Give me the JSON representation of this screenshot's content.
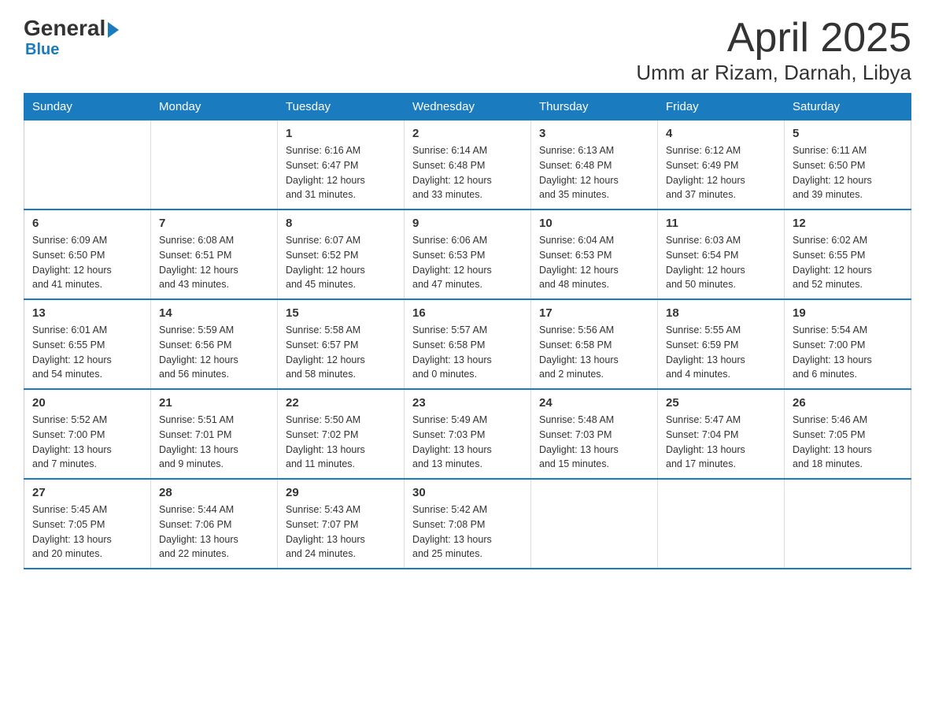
{
  "logo": {
    "general": "General",
    "blue": "Blue"
  },
  "title": "April 2025",
  "subtitle": "Umm ar Rizam, Darnah, Libya",
  "days_of_week": [
    "Sunday",
    "Monday",
    "Tuesday",
    "Wednesday",
    "Thursday",
    "Friday",
    "Saturday"
  ],
  "weeks": [
    [
      {
        "day": "",
        "info": ""
      },
      {
        "day": "",
        "info": ""
      },
      {
        "day": "1",
        "info": "Sunrise: 6:16 AM\nSunset: 6:47 PM\nDaylight: 12 hours\nand 31 minutes."
      },
      {
        "day": "2",
        "info": "Sunrise: 6:14 AM\nSunset: 6:48 PM\nDaylight: 12 hours\nand 33 minutes."
      },
      {
        "day": "3",
        "info": "Sunrise: 6:13 AM\nSunset: 6:48 PM\nDaylight: 12 hours\nand 35 minutes."
      },
      {
        "day": "4",
        "info": "Sunrise: 6:12 AM\nSunset: 6:49 PM\nDaylight: 12 hours\nand 37 minutes."
      },
      {
        "day": "5",
        "info": "Sunrise: 6:11 AM\nSunset: 6:50 PM\nDaylight: 12 hours\nand 39 minutes."
      }
    ],
    [
      {
        "day": "6",
        "info": "Sunrise: 6:09 AM\nSunset: 6:50 PM\nDaylight: 12 hours\nand 41 minutes."
      },
      {
        "day": "7",
        "info": "Sunrise: 6:08 AM\nSunset: 6:51 PM\nDaylight: 12 hours\nand 43 minutes."
      },
      {
        "day": "8",
        "info": "Sunrise: 6:07 AM\nSunset: 6:52 PM\nDaylight: 12 hours\nand 45 minutes."
      },
      {
        "day": "9",
        "info": "Sunrise: 6:06 AM\nSunset: 6:53 PM\nDaylight: 12 hours\nand 47 minutes."
      },
      {
        "day": "10",
        "info": "Sunrise: 6:04 AM\nSunset: 6:53 PM\nDaylight: 12 hours\nand 48 minutes."
      },
      {
        "day": "11",
        "info": "Sunrise: 6:03 AM\nSunset: 6:54 PM\nDaylight: 12 hours\nand 50 minutes."
      },
      {
        "day": "12",
        "info": "Sunrise: 6:02 AM\nSunset: 6:55 PM\nDaylight: 12 hours\nand 52 minutes."
      }
    ],
    [
      {
        "day": "13",
        "info": "Sunrise: 6:01 AM\nSunset: 6:55 PM\nDaylight: 12 hours\nand 54 minutes."
      },
      {
        "day": "14",
        "info": "Sunrise: 5:59 AM\nSunset: 6:56 PM\nDaylight: 12 hours\nand 56 minutes."
      },
      {
        "day": "15",
        "info": "Sunrise: 5:58 AM\nSunset: 6:57 PM\nDaylight: 12 hours\nand 58 minutes."
      },
      {
        "day": "16",
        "info": "Sunrise: 5:57 AM\nSunset: 6:58 PM\nDaylight: 13 hours\nand 0 minutes."
      },
      {
        "day": "17",
        "info": "Sunrise: 5:56 AM\nSunset: 6:58 PM\nDaylight: 13 hours\nand 2 minutes."
      },
      {
        "day": "18",
        "info": "Sunrise: 5:55 AM\nSunset: 6:59 PM\nDaylight: 13 hours\nand 4 minutes."
      },
      {
        "day": "19",
        "info": "Sunrise: 5:54 AM\nSunset: 7:00 PM\nDaylight: 13 hours\nand 6 minutes."
      }
    ],
    [
      {
        "day": "20",
        "info": "Sunrise: 5:52 AM\nSunset: 7:00 PM\nDaylight: 13 hours\nand 7 minutes."
      },
      {
        "day": "21",
        "info": "Sunrise: 5:51 AM\nSunset: 7:01 PM\nDaylight: 13 hours\nand 9 minutes."
      },
      {
        "day": "22",
        "info": "Sunrise: 5:50 AM\nSunset: 7:02 PM\nDaylight: 13 hours\nand 11 minutes."
      },
      {
        "day": "23",
        "info": "Sunrise: 5:49 AM\nSunset: 7:03 PM\nDaylight: 13 hours\nand 13 minutes."
      },
      {
        "day": "24",
        "info": "Sunrise: 5:48 AM\nSunset: 7:03 PM\nDaylight: 13 hours\nand 15 minutes."
      },
      {
        "day": "25",
        "info": "Sunrise: 5:47 AM\nSunset: 7:04 PM\nDaylight: 13 hours\nand 17 minutes."
      },
      {
        "day": "26",
        "info": "Sunrise: 5:46 AM\nSunset: 7:05 PM\nDaylight: 13 hours\nand 18 minutes."
      }
    ],
    [
      {
        "day": "27",
        "info": "Sunrise: 5:45 AM\nSunset: 7:05 PM\nDaylight: 13 hours\nand 20 minutes."
      },
      {
        "day": "28",
        "info": "Sunrise: 5:44 AM\nSunset: 7:06 PM\nDaylight: 13 hours\nand 22 minutes."
      },
      {
        "day": "29",
        "info": "Sunrise: 5:43 AM\nSunset: 7:07 PM\nDaylight: 13 hours\nand 24 minutes."
      },
      {
        "day": "30",
        "info": "Sunrise: 5:42 AM\nSunset: 7:08 PM\nDaylight: 13 hours\nand 25 minutes."
      },
      {
        "day": "",
        "info": ""
      },
      {
        "day": "",
        "info": ""
      },
      {
        "day": "",
        "info": ""
      }
    ]
  ]
}
